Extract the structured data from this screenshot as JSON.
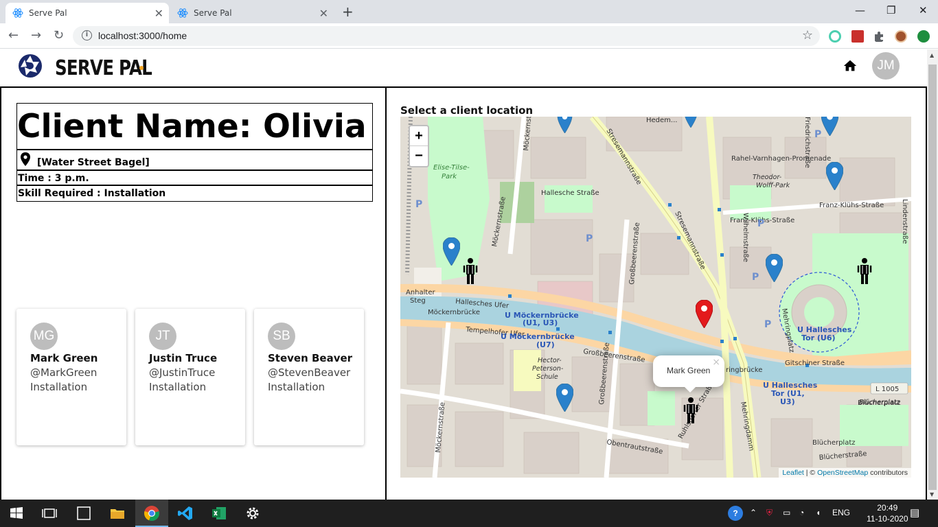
{
  "browser": {
    "tabs": [
      {
        "title": "Serve Pal",
        "active": true
      },
      {
        "title": "Serve Pal",
        "active": false
      }
    ],
    "url": "localhost:3000/home"
  },
  "header": {
    "brand": "SERVE PAL",
    "user_initials": "JM"
  },
  "client": {
    "name_line": "Client Name: Olivia",
    "location": "[Water Street Bagel]",
    "time": "Time : 3 p.m.",
    "skill": "Skill Required : Installation"
  },
  "servers": [
    {
      "initials": "MG",
      "name": "Mark Green",
      "handle": "@MarkGreen",
      "skill": "Installation"
    },
    {
      "initials": "JT",
      "name": "Justin Truce",
      "handle": "@JustinTruce",
      "skill": "Installation"
    },
    {
      "initials": "SB",
      "name": "Steven Beaver",
      "handle": "@StevenBeaver",
      "skill": "Installation"
    }
  ],
  "map": {
    "title": "Select a client location",
    "zoom_in": "+",
    "zoom_out": "−",
    "popup_text": "Mark Green",
    "popup_close": "×",
    "attribution_leaflet": "Leaflet",
    "attribution_sep": " | © ",
    "attribution_osm": "OpenStreetMap",
    "attribution_tail": " contributors",
    "labels": {
      "hallesches_ufer": "Hallesches Ufer",
      "mockernbrucke": "Möckernbrücke",
      "tempelhofer_ufer": "Tempelhofer Ufer",
      "u_mockern_1": "U Möckernbrücke",
      "u_mockern_1b": "(U1, U3)",
      "u_mockern_2": "U Möckernbrücke",
      "u_mockern_2b": "(U7)",
      "grossbeeren": "Großbeerenstraße",
      "u_hallesches_tor": "U Hallesches",
      "u_hallesches_tor_b": "Tor (U6)",
      "u_hallesches_tor2": "U Hallesches",
      "u_hallesches_tor2_b": "Tor (U1,",
      "u_hallesches_tor2_c": "U3)",
      "gitschiner": "Gitschiner Straße",
      "obentrautstrasse": "Obentrautstraße",
      "stresemann": "Stresemannstraße",
      "wilhelm": "Wilhelmstraße",
      "franz_kluhs": "Franz-Klühs-Straße",
      "rahel": "Rahel-Varnhagen-Promenade",
      "theodor": "Theodor-",
      "theodor_b": "Wolff-Park",
      "hallesche_strasse": "Hallesche Straße",
      "elise": "Elise-Tilse-",
      "elise_b": "Park",
      "anhalter": "Anhalter",
      "anhalter_b": "Steg",
      "mehringdamm": "Mehringdamm",
      "l1005": "L 1005",
      "blucherplatz": "Blücherplatz",
      "blucherstrasse": "Blücherstraße",
      "hector": "Hector-",
      "hector_b": "Peterson-",
      "hector_c": "Schule",
      "mehringplatz": "Mehringplatz",
      "friedrich": "Friedrichstraße",
      "lindenstr": "Lindenstraße",
      "ruhlsdorfer": "Ruhlsdorfer Straße",
      "mockernstr": "Möckernstraße",
      "hedemann": "Hedem..."
    },
    "colors": {
      "blue_marker": "#2a81cb",
      "red_marker": "#e31a1c",
      "water": "#aad3df",
      "park": "#c8facc",
      "major_road": "#fcd6a4",
      "secondary_road": "#f7fabf"
    }
  },
  "taskbar": {
    "lang": "ENG",
    "time": "20:49",
    "date": "11-10-2020"
  }
}
